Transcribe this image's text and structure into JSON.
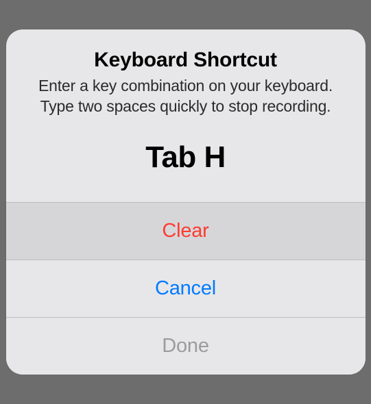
{
  "alert": {
    "title": "Keyboard Shortcut",
    "message": "Enter a key combination on your keyboard. Type two spaces quickly to stop recording.",
    "recorded_value": "Tab H",
    "buttons": {
      "clear": "Clear",
      "cancel": "Cancel",
      "done": "Done"
    }
  }
}
